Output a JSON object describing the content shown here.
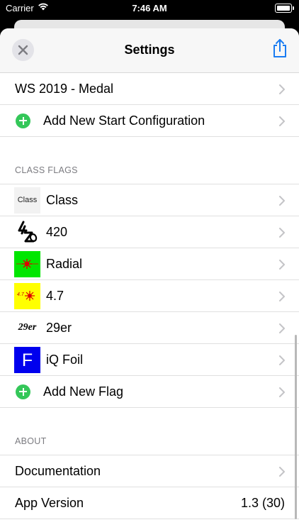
{
  "status_bar": {
    "carrier": "Carrier",
    "time": "7:46 AM"
  },
  "navbar": {
    "title": "Settings"
  },
  "start_configs": [
    {
      "label": "WS 2019 - Medal"
    }
  ],
  "add_start_config_label": "Add New Start Configuration",
  "class_flags": {
    "header": "CLASS FLAGS",
    "items": [
      {
        "label": "Class",
        "thumb_text": "Class",
        "thumb_bg": "#f2f2f2"
      },
      {
        "label": "420",
        "thumb_text": "420",
        "thumb_bg": "#ffffff"
      },
      {
        "label": "Radial",
        "thumb_bg": "#00e600"
      },
      {
        "label": "4.7",
        "thumb_text": "4.7",
        "thumb_bg": "#ffff00"
      },
      {
        "label": "29er",
        "thumb_text": "29er",
        "thumb_bg": "#ffffff"
      },
      {
        "label": "iQ Foil",
        "thumb_text": "F",
        "thumb_bg": "#0000ee"
      }
    ],
    "add_label": "Add New Flag"
  },
  "about": {
    "header": "ABOUT",
    "documentation_label": "Documentation",
    "app_version_label": "App Version",
    "app_version_value": "1.3 (30)"
  },
  "colors": {
    "accent": "#1a7cf2",
    "add_green": "#34c759",
    "chevron": "#c4c4c7"
  }
}
